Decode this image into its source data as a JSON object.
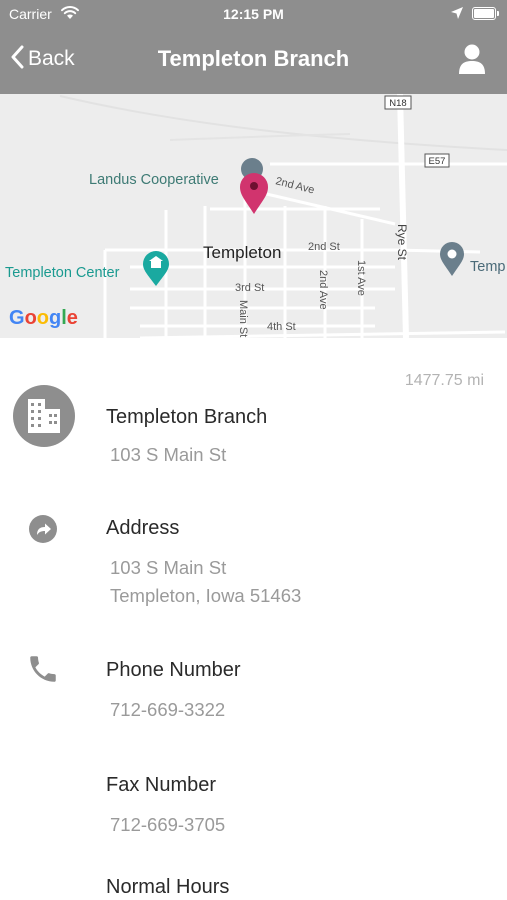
{
  "status_bar": {
    "carrier": "Carrier",
    "time": "12:15 PM",
    "wifi_icon": "wifi-icon",
    "location_icon": "location-arrow-icon",
    "battery_icon": "battery-icon"
  },
  "nav": {
    "back_label": "Back",
    "title": "Templeton Branch",
    "back_icon": "chevron-left-icon",
    "profile_icon": "user-icon"
  },
  "map": {
    "labels": {
      "landus": "Landus Cooperative",
      "second_ave_diag": "2nd Ave",
      "templeton": "Templeton",
      "second_st": "2nd St",
      "rye_st": "Rye St",
      "templeton_center": "Templeton Center",
      "temp_partial": "Temp",
      "third_st": "3rd St",
      "second_ave": "2nd Ave",
      "first_ave": "1st Ave",
      "main_st": "Main St",
      "fourth_st": "4th St",
      "n18": "N18",
      "e57": "E57"
    },
    "google_logo": "Google",
    "pin_color": "#d1346e"
  },
  "detail": {
    "distance": "1477.75 mi",
    "branch": {
      "name": "Templeton Branch",
      "street": "103 S Main St",
      "icon": "building-icon"
    },
    "address": {
      "label": "Address",
      "line1": "103 S Main St",
      "line2": "Templeton, Iowa 51463",
      "icon": "directions-icon"
    },
    "phone": {
      "label": "Phone Number",
      "value": "712-669-3322",
      "icon": "phone-icon"
    },
    "fax": {
      "label": "Fax Number",
      "value": "712-669-3705"
    },
    "hours": {
      "label": "Normal Hours"
    }
  },
  "colors": {
    "header_bg": "#8e8e8e",
    "map_bg": "#ededed",
    "pin": "#d1346e",
    "icon_gray": "#8e8e8e",
    "secondary_text": "#9a9a9a"
  }
}
